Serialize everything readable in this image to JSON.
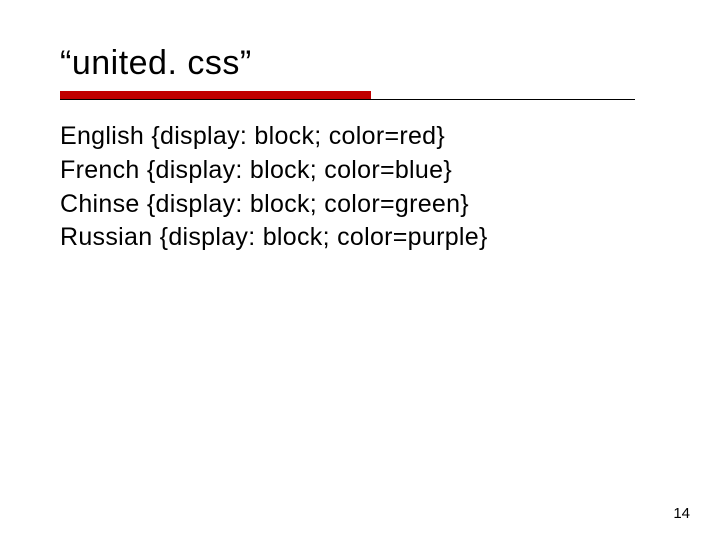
{
  "title": "“united. css”",
  "lines": [
    "English {display: block; color=red}",
    "French {display: block; color=blue}",
    "Chinse {display: block; color=green}",
    "Russian {display: block; color=purple}"
  ],
  "page_number": "14"
}
